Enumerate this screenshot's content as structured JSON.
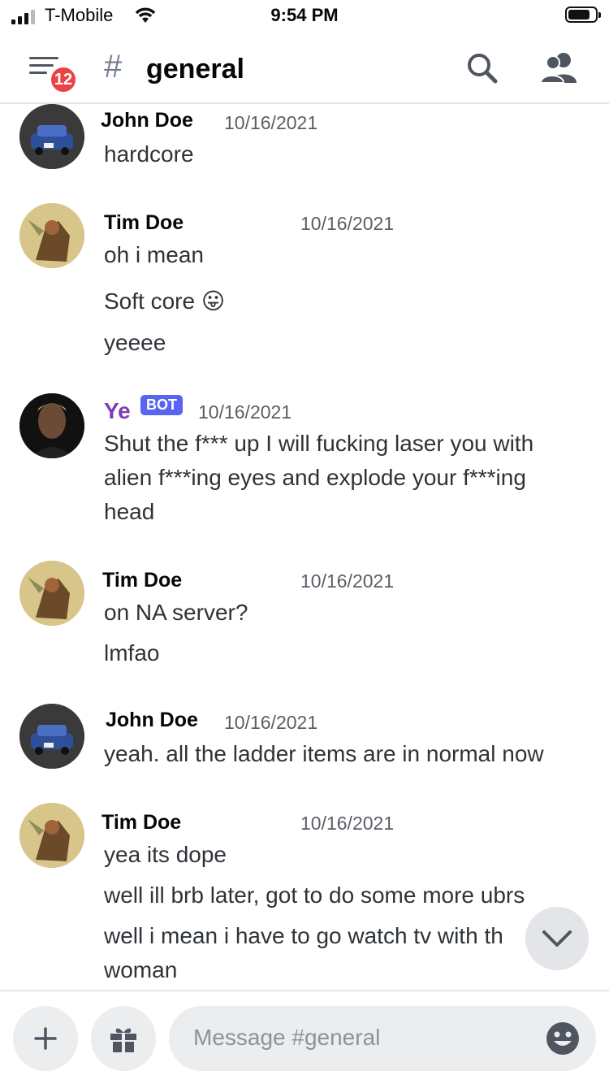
{
  "status_bar": {
    "carrier": "T-Mobile",
    "time": "9:54 PM"
  },
  "header": {
    "menu_badge": "12",
    "channel_hash": "#",
    "channel_name": "general"
  },
  "messages": [
    {
      "author": "John Doe",
      "timestamp": "10/16/2021",
      "lines": [
        "hardcore"
      ],
      "avatar": "car-avatar"
    },
    {
      "author": "Tim Doe",
      "timestamp": "10/16/2021",
      "lines": [
        "oh i mean",
        "Soft core 😛",
        "yeeee"
      ],
      "avatar": "warrior-avatar"
    },
    {
      "author": "Ye",
      "badge": "BOT",
      "timestamp": "10/16/2021",
      "lines": [
        "Shut the f***  up I will fucking laser you with",
        "alien f***ing eyes and explode your f***ing",
        "head"
      ],
      "avatar": "portrait-avatar",
      "author_color": "#7d3cb5"
    },
    {
      "author": "Tim Doe",
      "timestamp": "10/16/2021",
      "lines": [
        "on NA server?",
        "lmfao"
      ],
      "avatar": "warrior-avatar"
    },
    {
      "author": "John Doe",
      "timestamp": "10/16/2021",
      "lines": [
        "yeah. all the ladder items are in normal now"
      ],
      "avatar": "car-avatar"
    },
    {
      "author": "Tim Doe",
      "timestamp": "10/16/2021",
      "lines": [
        "yea its dope",
        "well ill brb later, got to do some more ubrs",
        "well i mean i have to go watch tv with th",
        "woman"
      ],
      "avatar": "warrior-avatar"
    }
  ],
  "composer": {
    "placeholder": "Message #general"
  }
}
